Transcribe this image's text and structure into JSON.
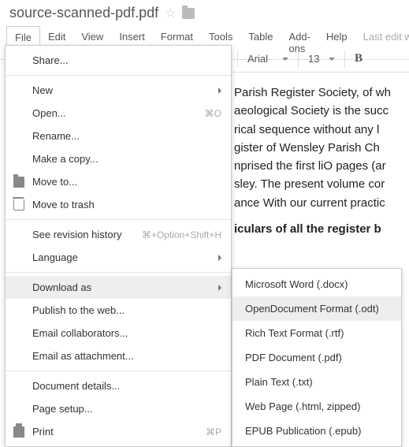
{
  "document": {
    "title": "source-scanned-pdf.pdf"
  },
  "menubar": {
    "file": "File",
    "edit": "Edit",
    "view": "View",
    "insert": "Insert",
    "format": "Format",
    "tools": "Tools",
    "table": "Table",
    "addons": "Add-ons",
    "help": "Help",
    "last_edit": "Last edit was"
  },
  "toolbar": {
    "font": "Arial",
    "size": "13",
    "bold": "B"
  },
  "body": {
    "l1": "Parish Register Society, of wh",
    "l2": "aeological Society is the succ",
    "l3": "rical sequence without any l",
    "l4": "gister of Wensley Parish Ch",
    "l5": "nprised the first liO pages (ar",
    "l6": "sley. The present volume cor",
    "l7": "ance With our current practic",
    "l8": "iculars of all the register b"
  },
  "file_menu": {
    "share": "Share...",
    "new": "New",
    "open": "Open...",
    "open_sc": "⌘O",
    "rename": "Rename...",
    "make_copy": "Make a copy...",
    "move_to": "Move to...",
    "trash": "Move to trash",
    "revision": "See revision history",
    "revision_sc": "⌘+Option+Shift+H",
    "language": "Language",
    "download": "Download as",
    "publish": "Publish to the web...",
    "email_collab": "Email collaborators...",
    "email_attach": "Email as attachment...",
    "details": "Document details...",
    "page_setup": "Page setup...",
    "print": "Print",
    "print_sc": "⌘P"
  },
  "download_menu": {
    "docx": "Microsoft Word (.docx)",
    "odt": "OpenDocument Format (.odt)",
    "rtf": "Rich Text Format (.rtf)",
    "pdf": "PDF Document (.pdf)",
    "txt": "Plain Text (.txt)",
    "html": "Web Page (.html, zipped)",
    "epub": "EPUB Publication (.epub)"
  }
}
